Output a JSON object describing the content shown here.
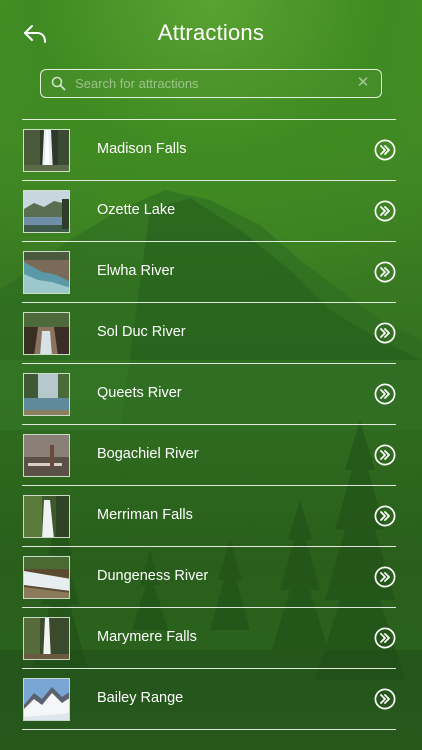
{
  "header": {
    "title": "Attractions",
    "back_icon": "back-arrow-icon"
  },
  "search": {
    "placeholder": "Search for attractions",
    "value": "",
    "icon": "search-icon",
    "clear_icon": "clear-icon"
  },
  "colors": {
    "background_top": "#4f9a2c",
    "background_bottom": "#2c6420",
    "text": "#ffffff",
    "divider": "#ffffff"
  },
  "attractions": [
    {
      "name": "Madison Falls",
      "thumb": "waterfall"
    },
    {
      "name": "Ozette Lake",
      "thumb": "lake"
    },
    {
      "name": "Elwha River",
      "thumb": "river-rocks"
    },
    {
      "name": "Sol Duc River",
      "thumb": "gorge"
    },
    {
      "name": "Queets River",
      "thumb": "river-valley"
    },
    {
      "name": "Bogachiel River",
      "thumb": "misty-river"
    },
    {
      "name": "Merriman Falls",
      "thumb": "waterfall-moss"
    },
    {
      "name": "Dungeness River",
      "thumb": "rapids"
    },
    {
      "name": "Marymere Falls",
      "thumb": "tall-waterfall"
    },
    {
      "name": "Bailey Range",
      "thumb": "snow-mountains"
    }
  ],
  "row_action_icon": "chevron-double-right-icon"
}
